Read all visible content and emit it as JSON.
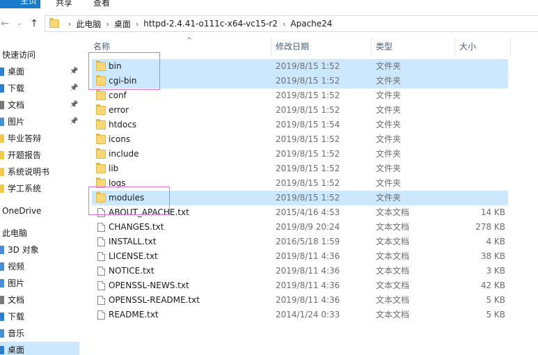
{
  "ribbon": {
    "tabs": [
      "主页",
      "共享",
      "查看"
    ]
  },
  "address": {
    "crumbs": [
      "此电脑",
      "桌面",
      "httpd-2.4.41-o111c-x64-vc15-r2",
      "Apache24"
    ]
  },
  "sidebar": {
    "items": [
      {
        "label": "快速访问",
        "head": true
      },
      {
        "label": "桌面",
        "pinned": true,
        "icon": "desktop-icon",
        "color": "#2f7fd0"
      },
      {
        "label": "下载",
        "pinned": true,
        "icon": "download-icon",
        "color": "#2f7fd0"
      },
      {
        "label": "文档",
        "pinned": true,
        "icon": "document-icon",
        "color": "#7a7a7a"
      },
      {
        "label": "图片",
        "pinned": true,
        "icon": "picture-icon",
        "color": "#4a8fd4"
      },
      {
        "label": "毕业答辩",
        "icon": "folder-icon",
        "color": "#f2c94c"
      },
      {
        "label": "开题报告",
        "icon": "folder-icon",
        "color": "#f2c94c"
      },
      {
        "label": "系统说明书",
        "icon": "folder-icon",
        "color": "#f2c94c"
      },
      {
        "label": "学工系统",
        "icon": "folder-icon",
        "color": "#f2c94c"
      },
      {
        "label": "OneDrive",
        "head": true
      },
      {
        "label": "此电脑",
        "head": true
      },
      {
        "label": "3D 对象",
        "icon": "3d-objects-icon",
        "color": "#4a8fd4"
      },
      {
        "label": "视频",
        "icon": "video-icon",
        "color": "#4a8fd4"
      },
      {
        "label": "图片",
        "icon": "picture-icon",
        "color": "#4a8fd4"
      },
      {
        "label": "文档",
        "icon": "document-icon",
        "color": "#7a7a7a"
      },
      {
        "label": "下载",
        "icon": "download-icon",
        "color": "#2f7fd0"
      },
      {
        "label": "音乐",
        "icon": "music-icon",
        "color": "#4a8fd4"
      },
      {
        "label": "桌面",
        "icon": "desktop-icon",
        "color": "#2f7fd0",
        "selected": true
      }
    ]
  },
  "columns": {
    "name": "名称",
    "date": "修改日期",
    "type": "类型",
    "size": "大小"
  },
  "files": [
    {
      "name": "bin",
      "date": "2019/8/15 1:52",
      "type": "文件夹",
      "size": "",
      "kind": "folder",
      "selected": true
    },
    {
      "name": "cgi-bin",
      "date": "2019/8/15 1:52",
      "type": "文件夹",
      "size": "",
      "kind": "folder",
      "selected": true
    },
    {
      "name": "conf",
      "date": "2019/8/15 1:52",
      "type": "文件夹",
      "size": "",
      "kind": "folder"
    },
    {
      "name": "error",
      "date": "2019/8/15 1:52",
      "type": "文件夹",
      "size": "",
      "kind": "folder"
    },
    {
      "name": "htdocs",
      "date": "2019/8/15 1:54",
      "type": "文件夹",
      "size": "",
      "kind": "folder"
    },
    {
      "name": "icons",
      "date": "2019/8/15 1:52",
      "type": "文件夹",
      "size": "",
      "kind": "folder"
    },
    {
      "name": "include",
      "date": "2019/8/15 1:52",
      "type": "文件夹",
      "size": "",
      "kind": "folder"
    },
    {
      "name": "lib",
      "date": "2019/8/15 1:52",
      "type": "文件夹",
      "size": "",
      "kind": "folder"
    },
    {
      "name": "logs",
      "date": "2019/8/15 1:52",
      "type": "文件夹",
      "size": "",
      "kind": "folder"
    },
    {
      "name": "modules",
      "date": "2019/8/15 1:52",
      "type": "文件夹",
      "size": "",
      "kind": "folder",
      "selected": true
    },
    {
      "name": "ABOUT_APACHE.txt",
      "date": "2015/4/16 4:53",
      "type": "文本文档",
      "size": "14 KB",
      "kind": "doc"
    },
    {
      "name": "CHANGES.txt",
      "date": "2019/8/9 20:24",
      "type": "文本文档",
      "size": "278 KB",
      "kind": "doc"
    },
    {
      "name": "INSTALL.txt",
      "date": "2016/5/18 1:59",
      "type": "文本文档",
      "size": "4 KB",
      "kind": "doc"
    },
    {
      "name": "LICENSE.txt",
      "date": "2019/8/11 4:36",
      "type": "文本文档",
      "size": "38 KB",
      "kind": "doc"
    },
    {
      "name": "NOTICE.txt",
      "date": "2019/8/11 4:36",
      "type": "文本文档",
      "size": "3 KB",
      "kind": "doc"
    },
    {
      "name": "OPENSSL-NEWS.txt",
      "date": "2019/8/11 4:36",
      "type": "文本文档",
      "size": "42 KB",
      "kind": "doc"
    },
    {
      "name": "OPENSSL-README.txt",
      "date": "2019/8/11 4:36",
      "type": "文本文档",
      "size": "5 KB",
      "kind": "doc"
    },
    {
      "name": "README.txt",
      "date": "2014/1/24 0:33",
      "type": "文本文档",
      "size": "5 KB",
      "kind": "doc"
    }
  ],
  "colors": {
    "selection": "#cce8ff",
    "annotation": "#e06be0",
    "accent": "#1979ca"
  }
}
